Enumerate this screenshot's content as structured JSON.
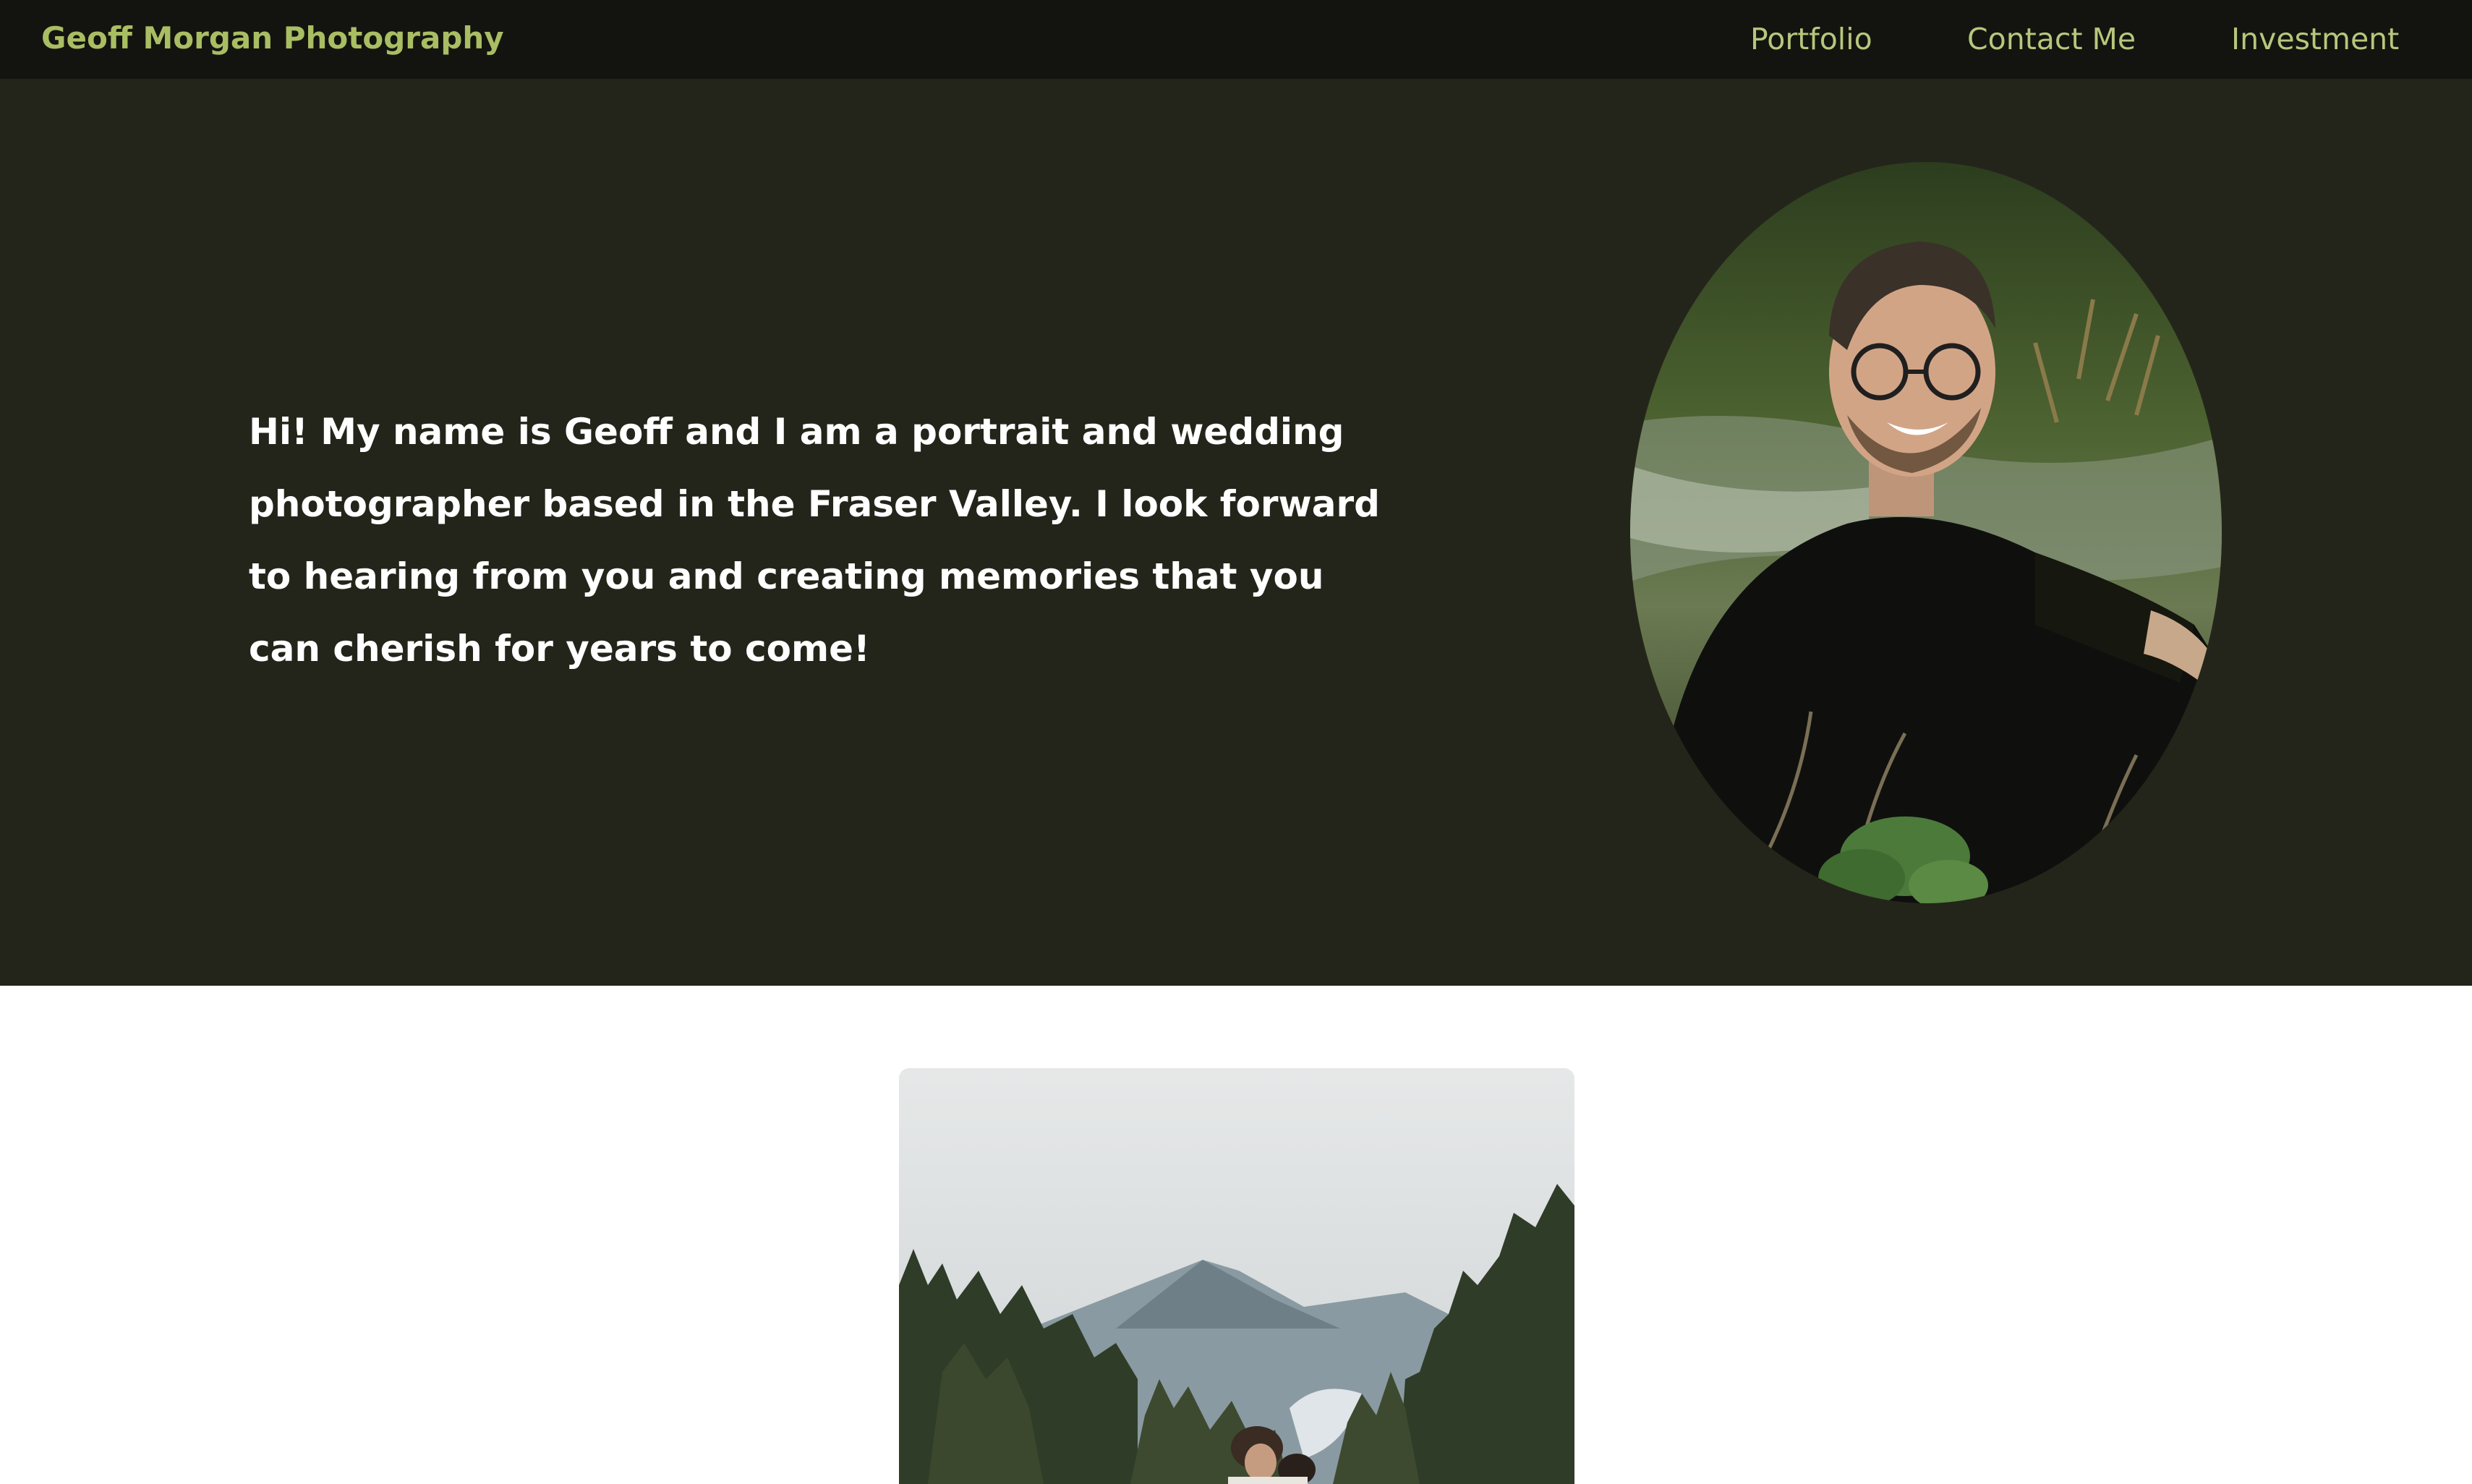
{
  "nav": {
    "brand": "Geoff Morgan Photography",
    "links": [
      {
        "label": "Portfolio"
      },
      {
        "label": "Contact Me"
      },
      {
        "label": "Investment"
      }
    ]
  },
  "hero": {
    "intro_lines": [
      "Hi! My name is Geoff and I am a portrait and wedding",
      "photographer based in the Fraser Valley. I look forward",
      "to hearing from you and creating memories that you",
      "can cherish for years to come!"
    ]
  },
  "colors": {
    "nav_bg": "#13140f",
    "hero_bg": "#24251a",
    "brand": "#a9bd63",
    "nav_link": "#b6c77c",
    "hero_text": "#ffffff"
  }
}
